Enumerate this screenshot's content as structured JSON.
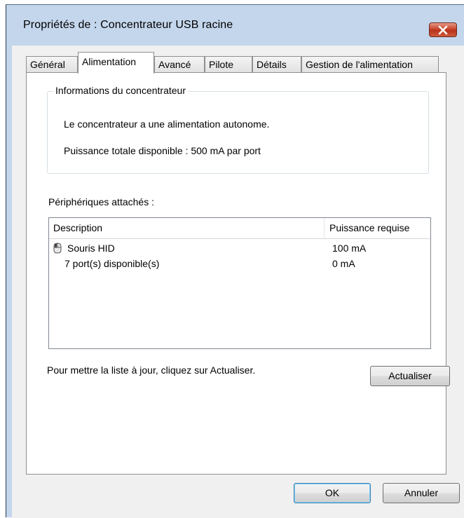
{
  "window": {
    "title": "Propriétés de : Concentrateur USB racine",
    "close_icon": "close-icon",
    "close_color": "#c9452c"
  },
  "tabs": [
    {
      "label": "Général",
      "active": false
    },
    {
      "label": "Alimentation",
      "active": true
    },
    {
      "label": "Avancé",
      "active": false
    },
    {
      "label": "Pilote",
      "active": false
    },
    {
      "label": "Détails",
      "active": false
    },
    {
      "label": "Gestion de l'alimentation",
      "active": false
    }
  ],
  "hub_info": {
    "legend": "Informations du concentrateur",
    "power_mode": "Le concentrateur a une alimentation autonome.",
    "total_power": "Puissance totale disponible : 500 mA par port"
  },
  "devices": {
    "label": "Périphériques attachés :",
    "columns": [
      "Description",
      "Puissance requise"
    ],
    "rows": [
      {
        "name": "Souris HID",
        "power": "100 mA",
        "icon": "mouse-icon"
      },
      {
        "name": "7 port(s) disponible(s)",
        "power": "0 mA",
        "icon": ""
      }
    ]
  },
  "refresh": {
    "hint": "Pour mettre la liste à jour, cliquez sur Actualiser.",
    "button_label": "Actualiser"
  },
  "footer": {
    "ok_label": "OK",
    "cancel_label": "Annuler"
  }
}
